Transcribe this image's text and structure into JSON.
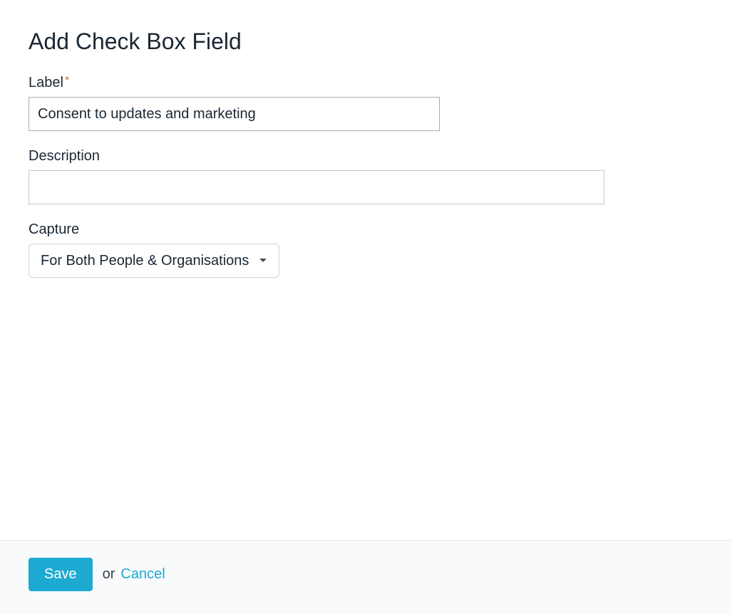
{
  "page": {
    "title": "Add Check Box Field"
  },
  "form": {
    "label": {
      "label": "Label",
      "required_mark": "*",
      "value": "Consent to updates and marketing"
    },
    "description": {
      "label": "Description",
      "value": ""
    },
    "capture": {
      "label": "Capture",
      "selected": "For Both People & Organisations"
    }
  },
  "footer": {
    "save": "Save",
    "or": "or",
    "cancel": "Cancel"
  }
}
